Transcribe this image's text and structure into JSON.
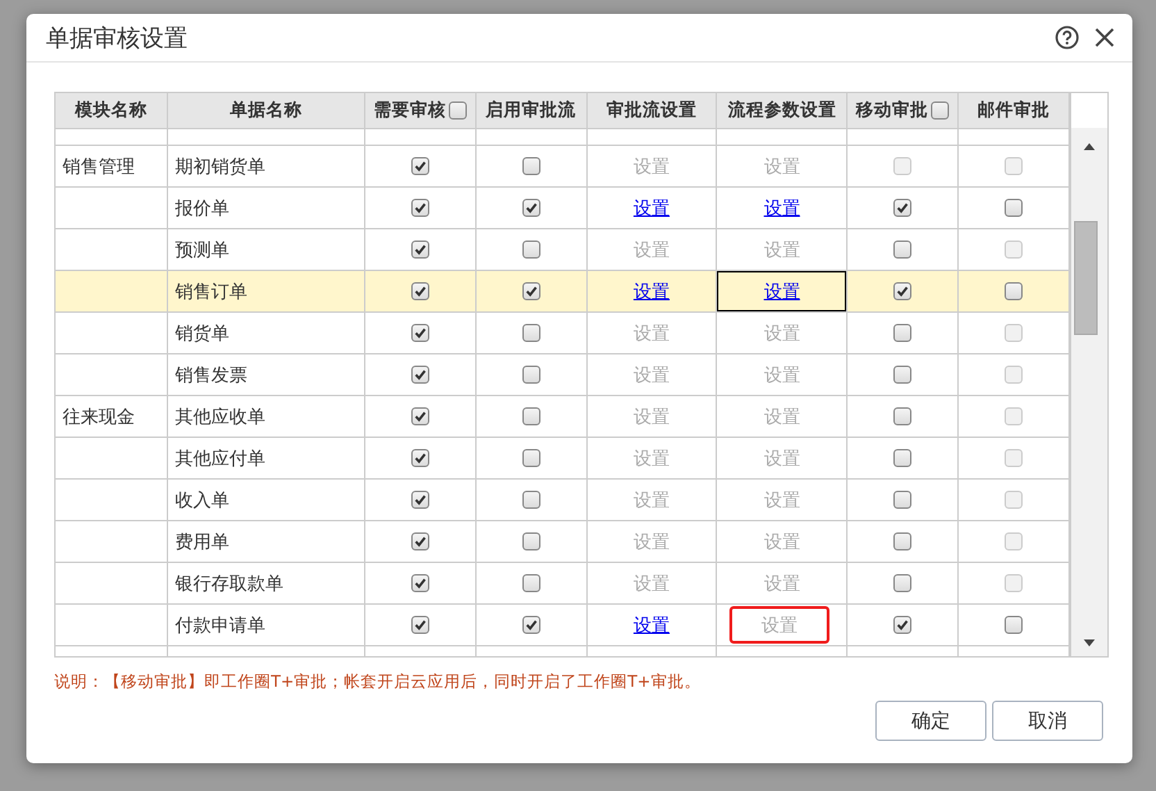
{
  "dialog": {
    "title": "单据审核设置"
  },
  "table": {
    "columns": [
      {
        "label": "模块名称",
        "kind": "text"
      },
      {
        "label": "单据名称",
        "kind": "text"
      },
      {
        "label": "需要审核",
        "kind": "checkbox",
        "checked": false
      },
      {
        "label": "启用审批流",
        "kind": "text"
      },
      {
        "label": "审批流设置",
        "kind": "text"
      },
      {
        "label": "流程参数设置",
        "kind": "text"
      },
      {
        "label": "移动审批",
        "kind": "checkbox",
        "checked": false
      },
      {
        "label": "邮件审批",
        "kind": "text"
      }
    ],
    "rows": [
      {
        "module": "销售管理",
        "name": "期初销货单",
        "selected": false,
        "need_audit": true,
        "approval_flow": false,
        "flow_link": {
          "label": "设置",
          "enabled": false
        },
        "param_link": {
          "label": "设置",
          "enabled": false,
          "focused": false,
          "marked": false
        },
        "mobile": {
          "checked": false,
          "disabled": true
        },
        "email": {
          "checked": false,
          "disabled": true
        }
      },
      {
        "name": "报价单",
        "selected": false,
        "need_audit": true,
        "approval_flow": true,
        "flow_link": {
          "label": "设置",
          "enabled": true
        },
        "param_link": {
          "label": "设置",
          "enabled": true,
          "focused": false,
          "marked": false
        },
        "mobile": {
          "checked": true,
          "disabled": false
        },
        "email": {
          "checked": false,
          "disabled": false
        }
      },
      {
        "name": "预测单",
        "selected": false,
        "need_audit": true,
        "approval_flow": false,
        "flow_link": {
          "label": "设置",
          "enabled": false
        },
        "param_link": {
          "label": "设置",
          "enabled": false,
          "focused": false,
          "marked": false
        },
        "mobile": {
          "checked": false,
          "disabled": false
        },
        "email": {
          "checked": false,
          "disabled": true
        }
      },
      {
        "name": "销售订单",
        "selected": true,
        "need_audit": true,
        "approval_flow": true,
        "flow_link": {
          "label": "设置",
          "enabled": true
        },
        "param_link": {
          "label": "设置",
          "enabled": true,
          "focused": true,
          "marked": false
        },
        "mobile": {
          "checked": true,
          "disabled": false
        },
        "email": {
          "checked": false,
          "disabled": false
        }
      },
      {
        "name": "销货单",
        "selected": false,
        "need_audit": true,
        "approval_flow": false,
        "flow_link": {
          "label": "设置",
          "enabled": false
        },
        "param_link": {
          "label": "设置",
          "enabled": false,
          "focused": false,
          "marked": false
        },
        "mobile": {
          "checked": false,
          "disabled": false
        },
        "email": {
          "checked": false,
          "disabled": true
        }
      },
      {
        "name": "销售发票",
        "selected": false,
        "need_audit": true,
        "approval_flow": false,
        "flow_link": {
          "label": "设置",
          "enabled": false
        },
        "param_link": {
          "label": "设置",
          "enabled": false,
          "focused": false,
          "marked": false
        },
        "mobile": {
          "checked": false,
          "disabled": false
        },
        "email": {
          "checked": false,
          "disabled": true
        }
      },
      {
        "module": "往来现金",
        "name": "其他应收单",
        "selected": false,
        "need_audit": true,
        "approval_flow": false,
        "flow_link": {
          "label": "设置",
          "enabled": false
        },
        "param_link": {
          "label": "设置",
          "enabled": false,
          "focused": false,
          "marked": false
        },
        "mobile": {
          "checked": false,
          "disabled": false
        },
        "email": {
          "checked": false,
          "disabled": true
        }
      },
      {
        "name": "其他应付单",
        "selected": false,
        "need_audit": true,
        "approval_flow": false,
        "flow_link": {
          "label": "设置",
          "enabled": false
        },
        "param_link": {
          "label": "设置",
          "enabled": false,
          "focused": false,
          "marked": false
        },
        "mobile": {
          "checked": false,
          "disabled": false
        },
        "email": {
          "checked": false,
          "disabled": true
        }
      },
      {
        "name": "收入单",
        "selected": false,
        "need_audit": true,
        "approval_flow": false,
        "flow_link": {
          "label": "设置",
          "enabled": false
        },
        "param_link": {
          "label": "设置",
          "enabled": false,
          "focused": false,
          "marked": false
        },
        "mobile": {
          "checked": false,
          "disabled": false
        },
        "email": {
          "checked": false,
          "disabled": true
        }
      },
      {
        "name": "费用单",
        "selected": false,
        "need_audit": true,
        "approval_flow": false,
        "flow_link": {
          "label": "设置",
          "enabled": false
        },
        "param_link": {
          "label": "设置",
          "enabled": false,
          "focused": false,
          "marked": false
        },
        "mobile": {
          "checked": false,
          "disabled": false
        },
        "email": {
          "checked": false,
          "disabled": true
        }
      },
      {
        "name": "银行存取款单",
        "selected": false,
        "need_audit": true,
        "approval_flow": false,
        "flow_link": {
          "label": "设置",
          "enabled": false
        },
        "param_link": {
          "label": "设置",
          "enabled": false,
          "focused": false,
          "marked": false
        },
        "mobile": {
          "checked": false,
          "disabled": false
        },
        "email": {
          "checked": false,
          "disabled": true
        }
      },
      {
        "name": "付款申请单",
        "selected": false,
        "need_audit": true,
        "approval_flow": true,
        "flow_link": {
          "label": "设置",
          "enabled": true
        },
        "param_link": {
          "label": "设置",
          "enabled": false,
          "focused": false,
          "marked": true
        },
        "mobile": {
          "checked": true,
          "disabled": false
        },
        "email": {
          "checked": false,
          "disabled": false
        }
      }
    ]
  },
  "note": "说明：【移动审批】即工作圈T+审批；帐套开启云应用后，同时开启了工作圈T+审批。",
  "buttons": [
    "确定",
    "取消"
  ]
}
